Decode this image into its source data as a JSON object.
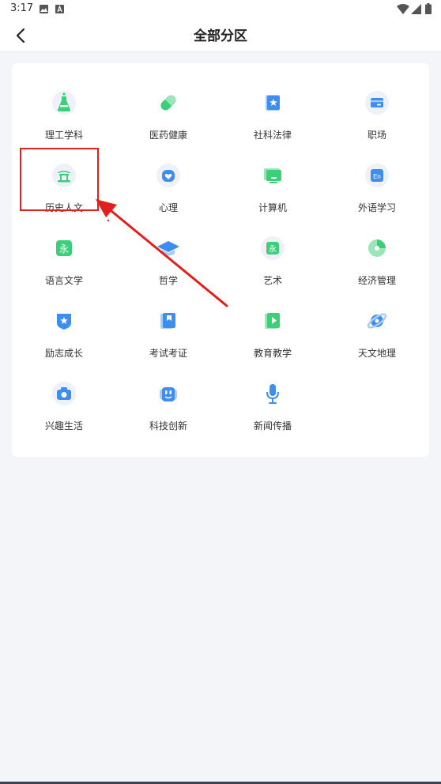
{
  "status_bar": {
    "time": "3:17"
  },
  "header": {
    "title": "全部分区"
  },
  "categories": [
    {
      "label": "理工学科",
      "icon": "flask-icon"
    },
    {
      "label": "医药健康",
      "icon": "pill-icon"
    },
    {
      "label": "社科法律",
      "icon": "star-badge-icon"
    },
    {
      "label": "职场",
      "icon": "card-icon"
    },
    {
      "label": "历史人文",
      "icon": "pavilion-icon"
    },
    {
      "label": "心理",
      "icon": "heart-icon"
    },
    {
      "label": "计算机",
      "icon": "monitor-icon"
    },
    {
      "label": "外语学习",
      "icon": "en-icon",
      "glyph": "En"
    },
    {
      "label": "语言文学",
      "icon": "yong-character-icon",
      "glyph": "永"
    },
    {
      "label": "哲学",
      "icon": "graduation-cap-icon"
    },
    {
      "label": "艺术",
      "icon": "yong-character-icon",
      "glyph": "永"
    },
    {
      "label": "经济管理",
      "icon": "pie-chart-icon"
    },
    {
      "label": "励志成长",
      "icon": "shield-star-icon"
    },
    {
      "label": "考试考证",
      "icon": "bookmark-book-icon"
    },
    {
      "label": "教育教学",
      "icon": "play-book-icon"
    },
    {
      "label": "天文地理",
      "icon": "planet-icon"
    },
    {
      "label": "兴趣生活",
      "icon": "camera-icon"
    },
    {
      "label": "科技创新",
      "icon": "robot-icon"
    },
    {
      "label": "新闻传播",
      "icon": "microphone-icon"
    }
  ],
  "colors": {
    "accent_green": "#3ccf7a",
    "accent_blue": "#3d8ef0",
    "highlight_red": "#e0201c"
  }
}
